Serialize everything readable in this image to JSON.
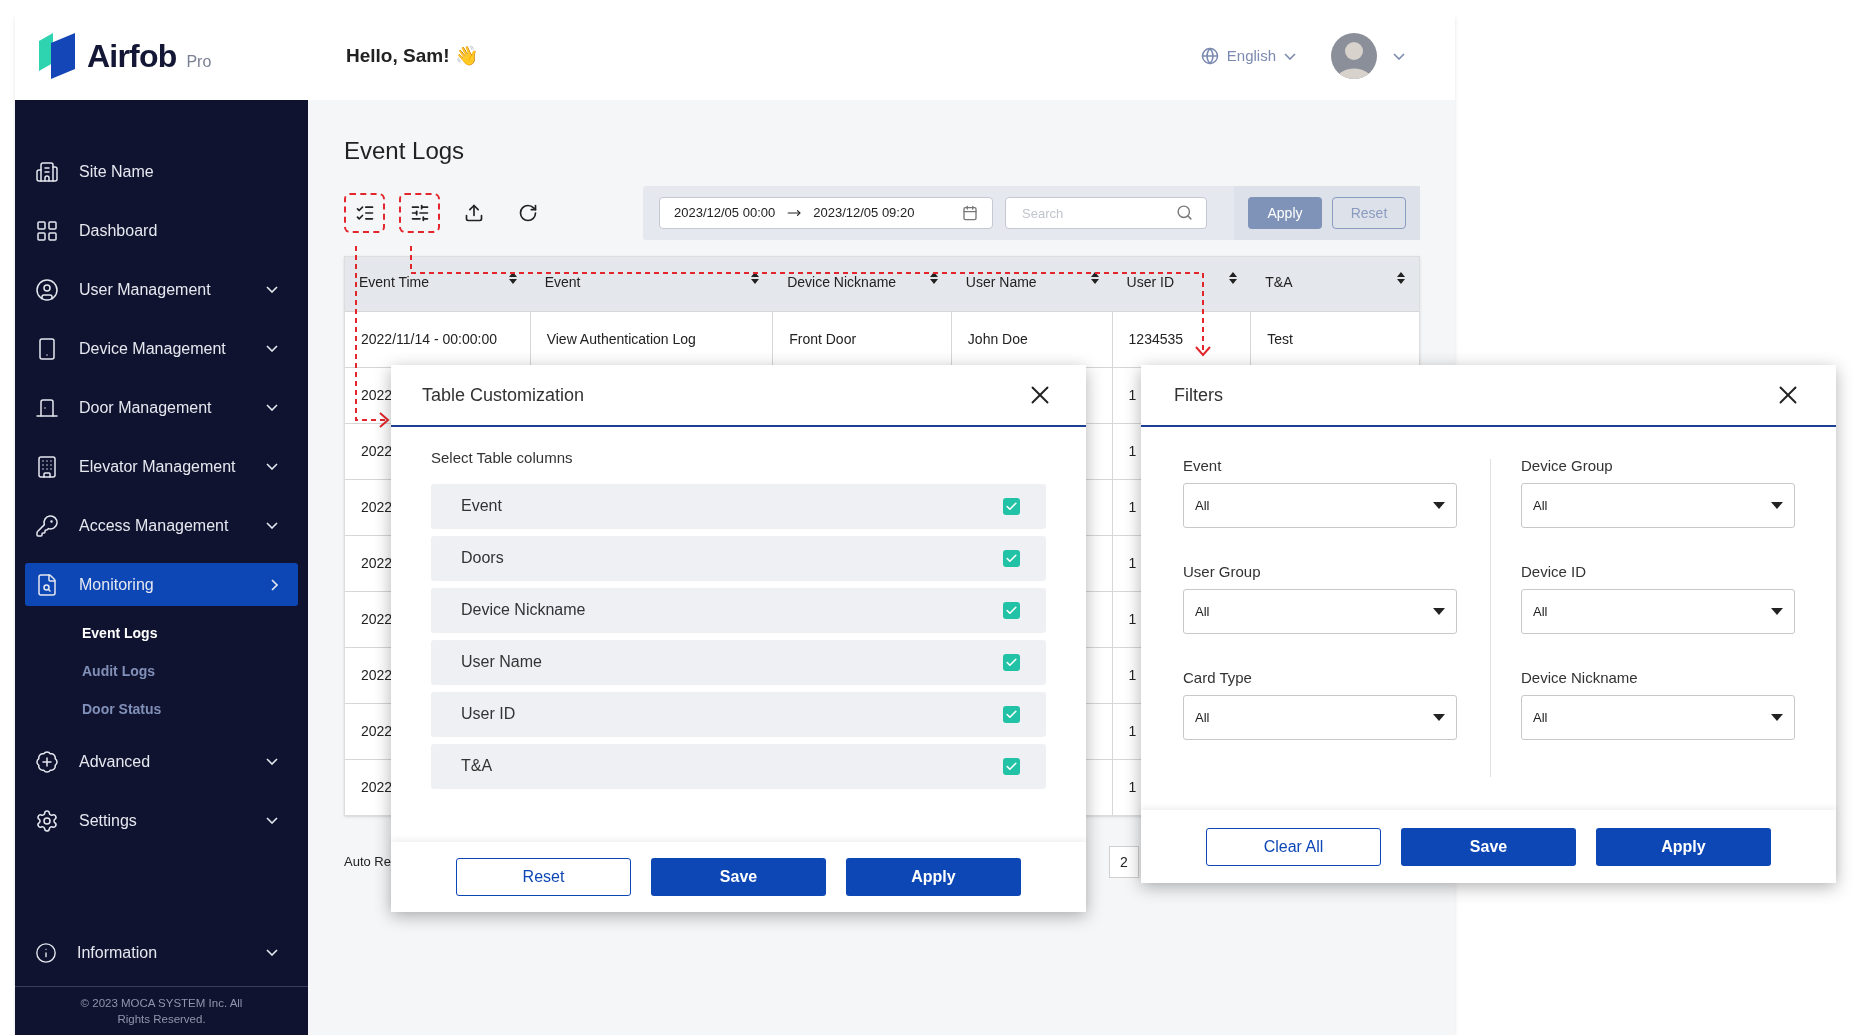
{
  "brand": {
    "name": "Airfob",
    "edition": "Pro"
  },
  "header": {
    "greeting": "Hello, Sam! 👋",
    "language": "English"
  },
  "sidebar": {
    "items": [
      {
        "label": "Site Name",
        "expandable": false,
        "selected": false
      },
      {
        "label": "Dashboard",
        "expandable": false,
        "selected": false
      },
      {
        "label": "User Management",
        "expandable": true,
        "selected": false
      },
      {
        "label": "Device Management",
        "expandable": true,
        "selected": false
      },
      {
        "label": "Door Management",
        "expandable": true,
        "selected": false
      },
      {
        "label": "Elevator Management",
        "expandable": true,
        "selected": false
      },
      {
        "label": "Access Management",
        "expandable": true,
        "selected": false
      },
      {
        "label": "Monitoring",
        "expandable": true,
        "selected": true,
        "children": [
          {
            "label": "Event Logs",
            "selected": true
          },
          {
            "label": "Audit Logs",
            "selected": false
          },
          {
            "label": "Door Status",
            "selected": false
          }
        ]
      },
      {
        "label": "Advanced",
        "expandable": true,
        "selected": false
      },
      {
        "label": "Settings",
        "expandable": true,
        "selected": false
      }
    ],
    "bottom_item": {
      "label": "Information",
      "expandable": true
    },
    "copyright": "© 2023 MOCA SYSTEM Inc. All Rights Reserved."
  },
  "page": {
    "title": "Event Logs"
  },
  "filter_bar": {
    "date_from": "2023/12/05 00:00",
    "date_to": "2023/12/05 09:20",
    "search_placeholder": "Search",
    "apply": "Apply",
    "reset": "Reset"
  },
  "table": {
    "columns": [
      "Event Time",
      "Event",
      "Device Nickname",
      "User Name",
      "User ID",
      "T&A"
    ],
    "rows": [
      {
        "event_time": "2022/11/14 - 00:00:00",
        "event": "View Authentication Log",
        "device_nickname": "Front Door",
        "user_name": "John Doe",
        "user_id": "1234535",
        "ta": "Test"
      },
      {
        "event_time": "2022",
        "user_id": "1"
      },
      {
        "event_time": "2022",
        "user_id": "1"
      },
      {
        "event_time": "2022",
        "user_id": "1"
      },
      {
        "event_time": "2022",
        "user_id": "1"
      },
      {
        "event_time": "2022",
        "user_id": "1"
      },
      {
        "event_time": "2022",
        "user_id": "1"
      },
      {
        "event_time": "2022",
        "user_id": "1"
      },
      {
        "event_time": "2022",
        "user_id": "1"
      }
    ]
  },
  "footer": {
    "auto_refresh": "Auto Re",
    "pages": [
      {
        "label": "2",
        "selected": false
      }
    ]
  },
  "table_customization": {
    "title": "Table Customization",
    "subtitle": "Select Table columns",
    "columns": [
      {
        "label": "Event",
        "checked": true
      },
      {
        "label": "Doors",
        "checked": true
      },
      {
        "label": "Device Nickname",
        "checked": true
      },
      {
        "label": "User Name",
        "checked": true
      },
      {
        "label": "User ID",
        "checked": true
      },
      {
        "label": "T&A",
        "checked": true
      }
    ],
    "buttons": [
      "Reset",
      "Save",
      "Apply"
    ]
  },
  "filters": {
    "title": "Filters",
    "fields": [
      {
        "label": "Event",
        "value": "All"
      },
      {
        "label": "Device Group",
        "value": "All"
      },
      {
        "label": "User Group",
        "value": "All"
      },
      {
        "label": "Device ID",
        "value": "All"
      },
      {
        "label": "Card Type",
        "value": "All"
      },
      {
        "label": "Device Nickname",
        "value": "All"
      }
    ],
    "buttons": [
      "Clear All",
      "Save",
      "Apply"
    ]
  }
}
